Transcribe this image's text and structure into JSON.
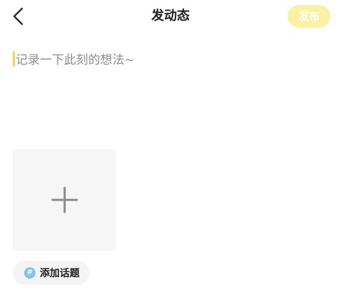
{
  "header": {
    "title": "发动态",
    "publish_label": "发布",
    "back_icon": "chevron-left-icon"
  },
  "composer": {
    "placeholder": "记录一下此刻的想法~",
    "value": ""
  },
  "media": {
    "add_icon": "plus-icon"
  },
  "topic": {
    "icon": "hashtag-icon",
    "icon_glyph": "#",
    "label": "添加话题"
  },
  "colors": {
    "publish_bg": "#fbf1a3",
    "cursor": "#f4d84a",
    "topic_icon_bg": "#7fc2f5",
    "tile_bg": "#f6f6f6"
  }
}
